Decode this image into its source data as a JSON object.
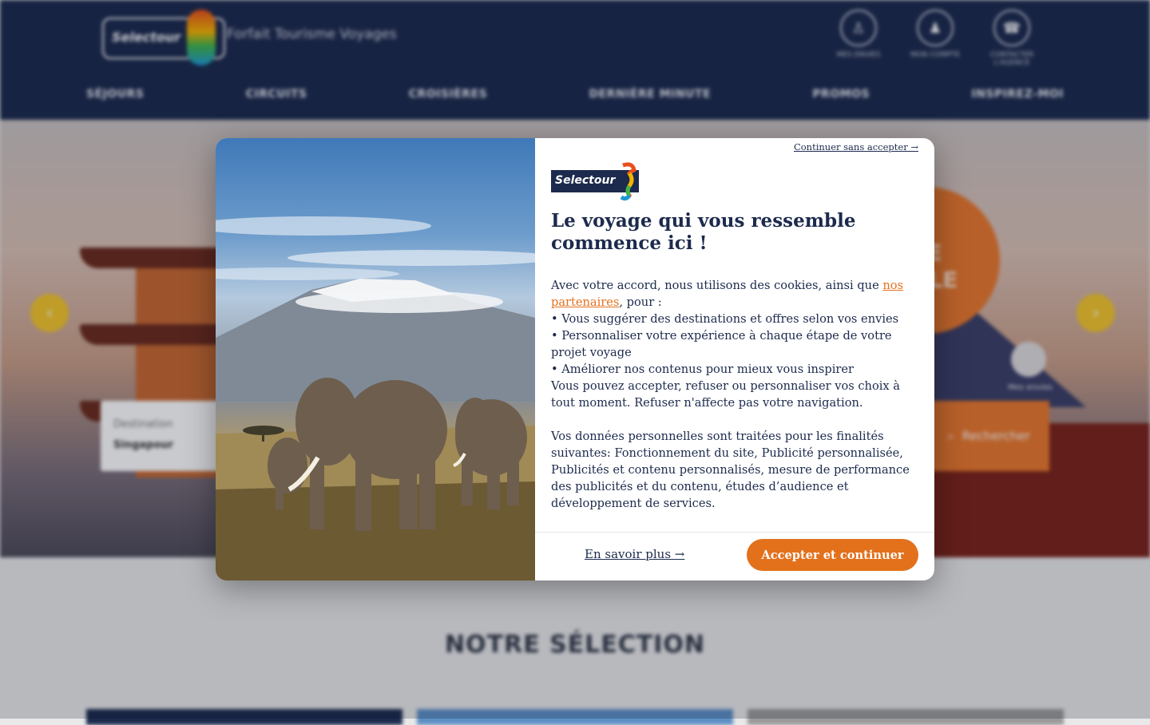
{
  "header": {
    "brand": "Selectour",
    "tagline": "Forfait Tourisme Voyages",
    "utilities": [
      {
        "label": "Mes envies",
        "icon": "user-icon"
      },
      {
        "label": "Mon compte",
        "icon": "person-icon"
      },
      {
        "label": "Contacter l'agence",
        "icon": "phone-icon"
      }
    ],
    "nav": [
      "SÉJOURS",
      "CIRCUITS",
      "CROISIÈRES",
      "DERNIÈRE MINUTE",
      "PROMOS",
      "INSPIREZ-MOI"
    ]
  },
  "hero": {
    "promo_text": "E\nALE",
    "search_label": "Destination",
    "search_value": "Singapour",
    "search_button": "Rechercher",
    "small_label": "Mes envies",
    "prev_arrow": "‹",
    "next_arrow": "›"
  },
  "section": {
    "title": "NOTRE SÉLECTION"
  },
  "consent": {
    "skip_link": "Continuer sans accepter →",
    "logo_text": "Selectour",
    "title": "Le voyage qui vous ressemble commence ici !",
    "intro_before": "Avec votre accord, nous utilisons des cookies, ainsi que ",
    "partners_link": "nos partenaires",
    "intro_after": ", pour :",
    "bullets": [
      "• Vous suggérer des destinations et offres selon vos envies",
      "• Personnaliser votre expérience à chaque étape de votre projet voyage",
      "• Améliorer nos contenus pour mieux vous inspirer"
    ],
    "choice_text": "Vous pouvez accepter, refuser ou personnaliser vos choix à tout moment. Refuser n'affecte pas votre navigation.",
    "purposes_text": "Vos données personnelles sont traitées pour les finalités suivantes: Fonctionnement du site, Publicité personnalisée, Publicités et contenu personnalisés, mesure de performance des publicités et du contenu, études d’audience et développement de services.",
    "learn_more": "En savoir plus →",
    "accept_button": "Accepter et continuer"
  },
  "colors": {
    "navy": "#1c2a4d",
    "accent": "#e3711c"
  }
}
